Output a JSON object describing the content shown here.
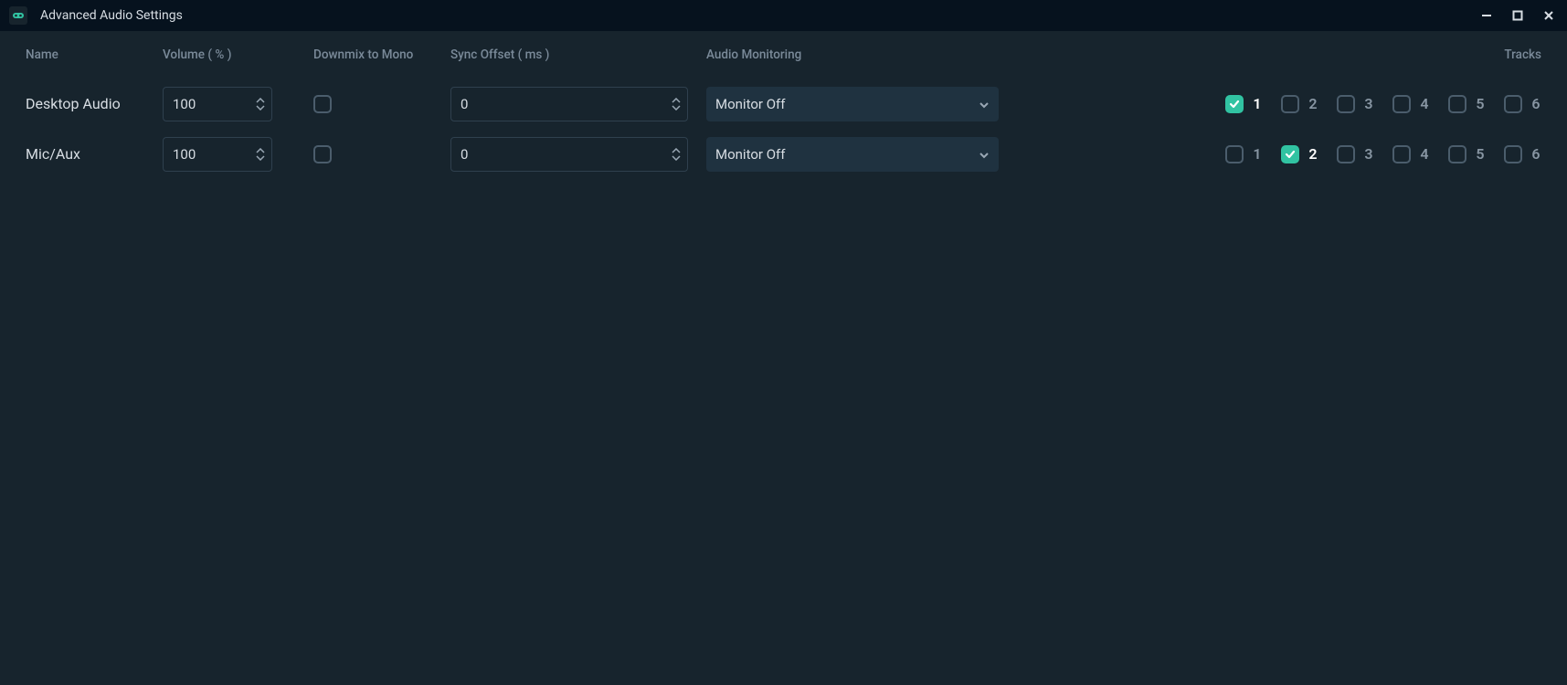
{
  "window": {
    "title": "Advanced Audio Settings"
  },
  "icons": {
    "app": "streamlabs-icon",
    "minimize": "minimize-icon",
    "maximize": "maximize-icon",
    "close": "close-icon",
    "chevron_down": "chevron-down-icon",
    "spinner_up": "caret-up-icon",
    "spinner_down": "caret-down-icon",
    "check": "check-icon"
  },
  "colors": {
    "accent": "#31c3a2",
    "bg_dark": "#06121e",
    "bg_panel": "#17242d",
    "bg_field": "#1f3240",
    "border": "#2f404e",
    "text": "#d7dde3",
    "text_muted": "#7a8a99"
  },
  "headers": {
    "name": "Name",
    "volume": "Volume ( % )",
    "downmix": "Downmix to Mono",
    "sync": "Sync Offset ( ms )",
    "monitoring": "Audio Monitoring",
    "tracks": "Tracks"
  },
  "track_labels": [
    "1",
    "2",
    "3",
    "4",
    "5",
    "6"
  ],
  "sources": [
    {
      "name": "Desktop Audio",
      "volume": "100",
      "downmix": false,
      "sync_offset": "0",
      "monitoring": "Monitor Off",
      "tracks": [
        true,
        false,
        false,
        false,
        false,
        false
      ]
    },
    {
      "name": "Mic/Aux",
      "volume": "100",
      "downmix": false,
      "sync_offset": "0",
      "monitoring": "Monitor Off",
      "tracks": [
        false,
        true,
        false,
        false,
        false,
        false
      ]
    }
  ]
}
